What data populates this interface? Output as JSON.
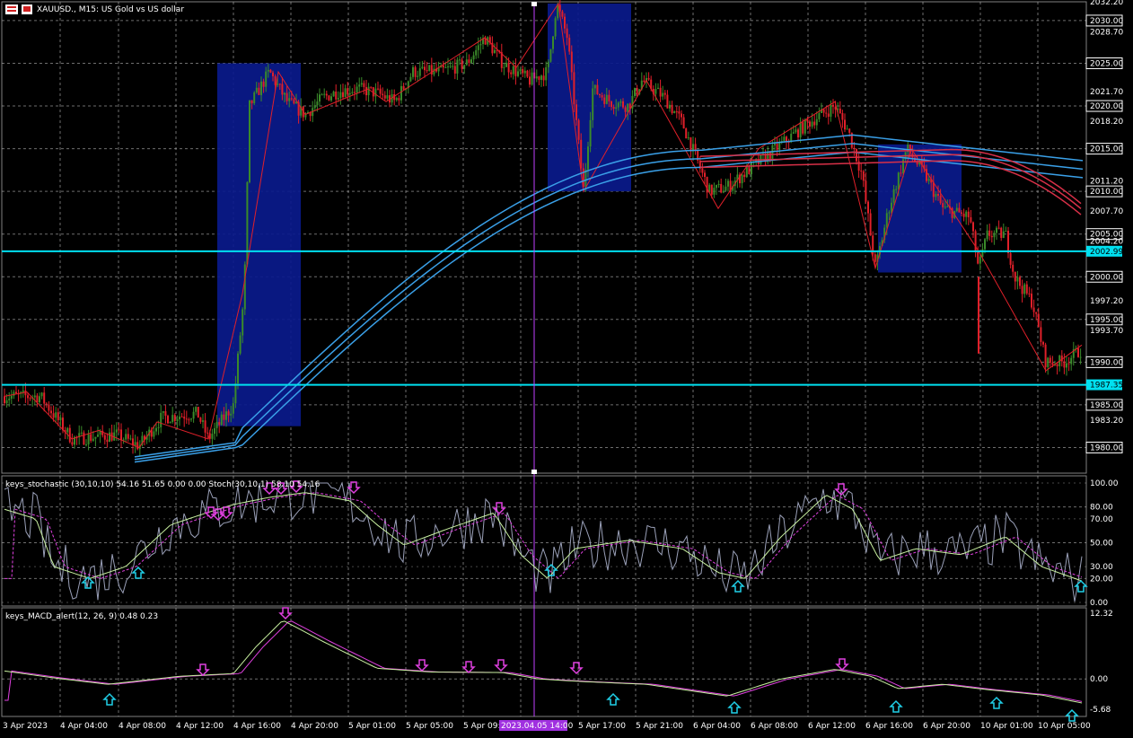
{
  "header": {
    "symbol_label": "XAUUSD., M15:  US Gold vs US dollar"
  },
  "colors": {
    "background": "#000000",
    "grid": "#c8c8c8",
    "bull_candle": "#3a8a2a",
    "bear_candle": "#e0202a",
    "ma_blue": "#3aa0e8",
    "ma_red": "#d83048",
    "zone": "#0a1a8c",
    "level_line": "#00e0f0",
    "vline": "#c040ff",
    "stoch_main": "#c8f0a0",
    "stoch_signal": "#e040e0",
    "stoch_raw": "#9aa0b8",
    "arrow_down": "#e040e0",
    "arrow_up": "#20d0e8"
  },
  "price_axis": {
    "labels": [
      "2032.20",
      "2030.00",
      "2028.70",
      "2025.00",
      "2021.70",
      "2020.00",
      "2018.20",
      "2015.00",
      "2011.20",
      "2010.00",
      "2007.70",
      "2005.00",
      "2004.20",
      "2002.99",
      "2000.00",
      "1997.20",
      "1995.00",
      "1993.70",
      "1990.00",
      "1987.35",
      "1985.00",
      "1983.20",
      "1980.00"
    ],
    "boxed": [
      "2030.00",
      "2025.00",
      "2020.00",
      "2015.00",
      "2010.00",
      "2005.00",
      "2000.00",
      "1995.00",
      "1990.00",
      "1985.00",
      "1980.00"
    ],
    "highlighted": [
      "2002.99",
      "1987.35"
    ],
    "level_lines": [
      2002.99,
      1987.35
    ]
  },
  "stoch_panel": {
    "label": "keys_stochastic (30,10,10) 54.16 51.65 0.00 0.00 Stoch(30,10,1) 58.10 54.16",
    "axis_labels": [
      "100.00",
      "80.00",
      "70.00",
      "50.00",
      "30.00",
      "20.00",
      "0.00"
    ]
  },
  "macd_panel": {
    "label": "keys_MACD_alert(12, 26, 9) 0.48 0.23",
    "axis_labels": [
      "12.32",
      "0.00",
      "-5.68"
    ]
  },
  "time_axis": {
    "labels": [
      "3 Apr 2023",
      "4 Apr 04:00",
      "4 Apr 08:00",
      "4 Apr 12:00",
      "4 Apr 16:00",
      "4 Apr 20:00",
      "5 Apr 01:00",
      "5 Apr 05:00",
      "5 Apr 09:00",
      "5 Apr 17:00",
      "5 Apr 21:00",
      "6 Apr 04:00",
      "6 Apr 08:00",
      "6 Apr 12:00",
      "6 Apr 16:00",
      "6 Apr 20:00",
      "10 Apr 01:00",
      "10 Apr 05:00"
    ],
    "cursor_label": "2023.04.05 14:00"
  }
}
